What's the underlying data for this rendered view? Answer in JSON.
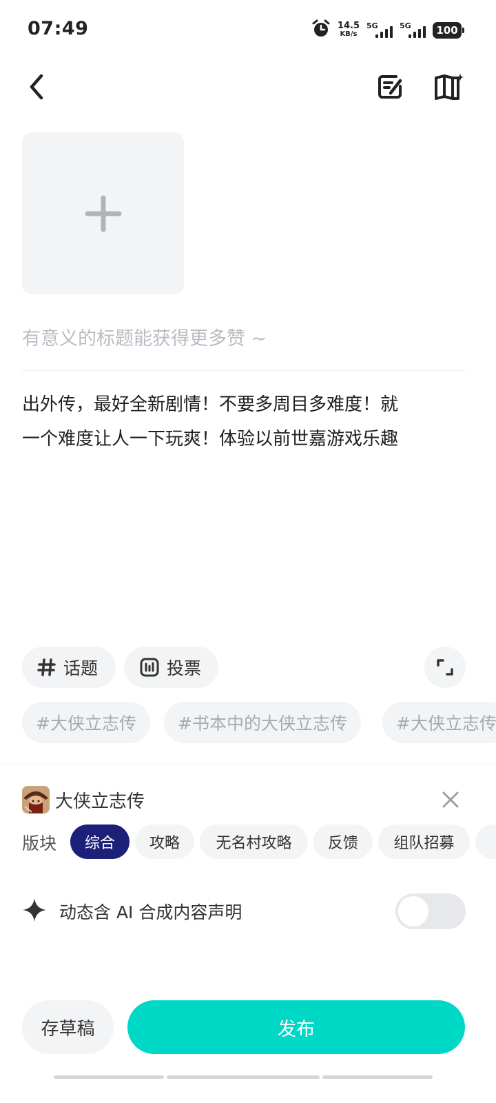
{
  "status_bar": {
    "time": "07:49",
    "net_speed_value": "14.5",
    "net_speed_unit": "KB/s",
    "signal_1": "5G",
    "signal_2": "5G",
    "battery": "100"
  },
  "nav": {
    "back_icon": "chevron-left-icon",
    "draft_box_icon": "edit-note-icon",
    "guide_icon": "book-sparkle-icon"
  },
  "editor": {
    "add_image_icon": "plus-icon",
    "title_placeholder": "有意义的标题能获得更多赞 ~",
    "body_line_1": "出外传，最好全新剧情！不要多周目多难度！就",
    "body_line_2": "一个难度让人一下玩爽！体验以前世嘉游戏乐趣"
  },
  "tools": {
    "topic_label": "话题",
    "vote_label": "投票"
  },
  "topics": [
    "#大侠立志传",
    "#书本中的大侠立志传",
    "#大侠立志传"
  ],
  "game": {
    "name": "大侠立志传"
  },
  "boards": {
    "label": "版块",
    "items": [
      "综合",
      "攻略",
      "无名村攻略",
      "反馈",
      "组队招募"
    ],
    "selected": "综合"
  },
  "ai_statement": {
    "label": "动态含 AI 合成内容声明",
    "enabled": false
  },
  "actions": {
    "save_draft": "存草稿",
    "publish": "发布"
  },
  "colors": {
    "accent": "#00d8c6",
    "selected_board": "#1c2078",
    "chip_bg": "#f3f4f6",
    "placeholder": "#b8bcc3"
  }
}
